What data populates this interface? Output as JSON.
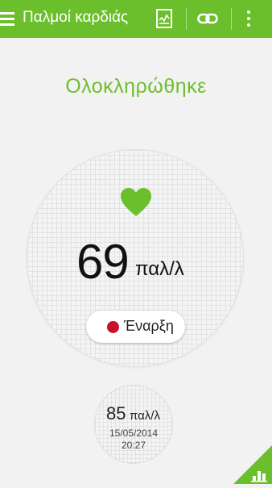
{
  "app": {
    "title": "Παλμοί καρδιάς",
    "accent_color": "#6cbf2c"
  },
  "toolbar": {
    "menu_icon": "hamburger-menu-icon",
    "report_icon": "report-chart-icon",
    "link_icon": "link-icon",
    "more_icon": "more-vertical-icon"
  },
  "measurement": {
    "status": "Ολοκληρώθηκε",
    "value": "69",
    "unit": "παλ/λ",
    "icon": "heart-icon",
    "heart_color": "#6cbf2c"
  },
  "start_button": {
    "label": "Έναρξη",
    "dot_color": "#c8102e"
  },
  "history": {
    "value": "85",
    "unit": "παλ/λ",
    "date": "15/05/2014",
    "time": "20:27"
  },
  "corner_tab": {
    "icon": "bar-chart-icon"
  }
}
